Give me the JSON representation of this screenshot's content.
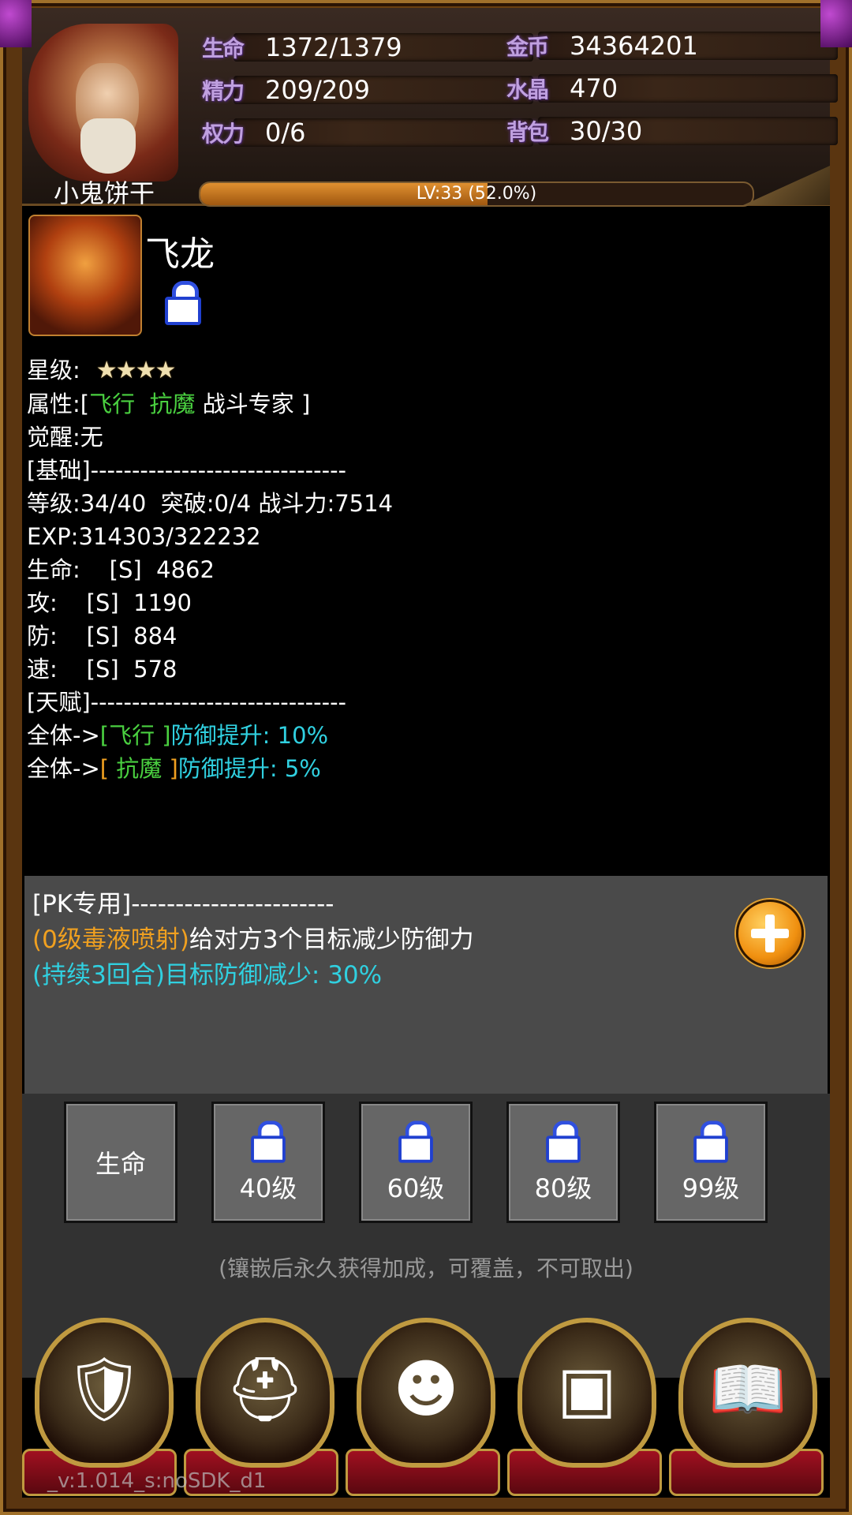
{
  "header": {
    "player_name": "小鬼饼干",
    "stats_left": [
      {
        "label": "生命",
        "value": "1372/1379"
      },
      {
        "label": "精力",
        "value": "209/209"
      },
      {
        "label": "权力",
        "value": "0/6"
      }
    ],
    "stats_right": [
      {
        "label": "金币",
        "value": "34364201"
      },
      {
        "label": "水晶",
        "value": "470"
      },
      {
        "label": "背包",
        "value": "30/30"
      }
    ],
    "level_text": "LV:33 (52.0%)",
    "level_progress": 0.52
  },
  "hero": {
    "name": "飞龙",
    "star_label": "星级:",
    "stars": "★★★★",
    "attr_prefix": "属性:[",
    "attr_1": "飞行",
    "attr_2": "抗魔",
    "attr_3": "战斗专家",
    "attr_suffix": "]",
    "awaken": "觉醒:无",
    "section_basic": "[基础]-------------------------------",
    "level_line": "等级:34/40  突破:0/4 战斗力:7514",
    "exp_line": "EXP:314303/322232",
    "hp_line": "生命:    [S]  4862",
    "atk_line": "攻:    [S]  1190",
    "def_line": "防:    [S]  884",
    "spd_line": "速:    [S]  578",
    "section_talent": "[天赋]-------------------------------",
    "talent_1_prefix": "全体->",
    "talent_1_tag": "[飞行 ]",
    "talent_1_effect": "防御提升: 10%",
    "talent_2_prefix": "全体->",
    "talent_2_tag_open": "[",
    "talent_2_tag": " 抗魔 ",
    "talent_2_tag_close": "]",
    "talent_2_effect": "防御提升: 5%"
  },
  "pk": {
    "title": "[PK专用]-----------------------",
    "skill": "(0级毒液喷射)",
    "skill_desc": "给对方3个目标减少防御力",
    "duration": "(持续3回合)目标防御减少: 30%"
  },
  "slots": [
    {
      "label": "生命",
      "locked": false
    },
    {
      "label": "40级",
      "locked": true
    },
    {
      "label": "60级",
      "locked": true
    },
    {
      "label": "80级",
      "locked": true
    },
    {
      "label": "99级",
      "locked": true
    }
  ],
  "slot_note": "(镶嵌后永久获得加成，可覆盖，不可取出)",
  "nav": [
    "shield-swords-icon",
    "warrior-helmet-icon",
    "masked-face-icon",
    "treasure-chest-icon",
    "book-icon"
  ],
  "version": "_v:1.014_s:noSDK_d1"
}
